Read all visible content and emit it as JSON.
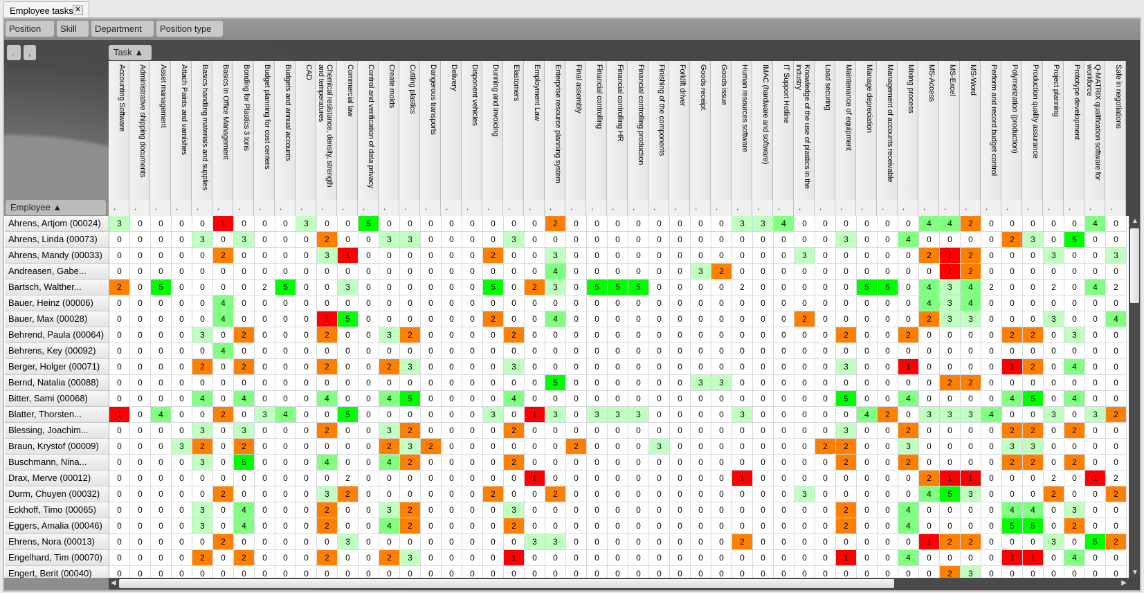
{
  "tab": {
    "title": "Employee tasks",
    "close_icon": "close-icon"
  },
  "filters": [
    "Position",
    "Skill",
    "Department",
    "Position type"
  ],
  "small_buttons": [
    ".",
    ","
  ],
  "task_sort_label": "Task ▲",
  "employee_sort_label": "Employee ▲",
  "colors": {
    "1": "#ff0000",
    "2": "#ff8000",
    "3": "#c0ffc0",
    "4": "#80ff80",
    "5": "#00ff00"
  },
  "filter_placeholder": ".",
  "tasks": [
    "Accounting Software",
    "Administrative shipping documents",
    "Asset management",
    "Attach Paints and varnishes",
    "Basics handling materials and supplies",
    "Basics in Office Management",
    "Bonding for Plastics 3 tons",
    "Budget planning for cost centers",
    "Budgets and annual accounts",
    "CAD",
    "Chemical resistance, density, strength and temperatures",
    "Commercial law",
    "Control and verification of data privacy",
    "Create molds",
    "Cutting plastics",
    "Dangerous transports",
    "Delivery",
    "Disponent vehicles",
    "Dunning and invoicing",
    "Elastomers",
    "Employment Law",
    "Enterprise resource planning system",
    "Final assembly",
    "Financial controlling",
    "Financial controlling HR",
    "Financial controlling production",
    "Finishing of the components",
    "Forklift driver",
    "Goods receipt",
    "Goods issue",
    "Human resources software",
    "IMAC (hardware and software)",
    "IT Support Hotline",
    "Knowledge of the use of plastics in the industry",
    "Load securing",
    "Maintenance of equipment",
    "Manage depreciation",
    "Management of accounts receivable",
    "Mixing process",
    "MS-Access",
    "MS-Excel",
    "MS-Word",
    "Perform and record budget control",
    "Polymerization (production)",
    "Production quality assurance",
    "Project planning",
    "Prototype development",
    "Q-MATRIX qualification software for workforce",
    "Safe in negotiations"
  ],
  "employees": [
    {
      "name": "Ahrens, Artjom (00024)",
      "values": [
        3,
        0,
        0,
        0,
        0,
        1,
        0,
        0,
        0,
        3,
        0,
        0,
        5,
        0,
        0,
        0,
        0,
        0,
        0,
        0,
        0,
        2,
        0,
        0,
        0,
        0,
        0,
        0,
        0,
        0,
        3,
        3,
        4,
        0,
        0,
        0,
        0,
        0,
        0,
        4,
        4,
        2,
        0,
        0,
        0,
        0,
        0,
        4,
        0
      ]
    },
    {
      "name": "Ahrens, Linda (00073)",
      "values": [
        0,
        0,
        0,
        0,
        3,
        0,
        3,
        0,
        0,
        0,
        2,
        0,
        0,
        3,
        3,
        0,
        0,
        0,
        0,
        3,
        0,
        0,
        0,
        0,
        0,
        0,
        0,
        0,
        0,
        0,
        0,
        0,
        0,
        0,
        0,
        3,
        0,
        0,
        4,
        0,
        0,
        0,
        0,
        2,
        3,
        0,
        5,
        0,
        0
      ]
    },
    {
      "name": "Ahrens, Mandy (00033)",
      "values": [
        0,
        0,
        0,
        0,
        0,
        2,
        0,
        0,
        0,
        0,
        3,
        1,
        0,
        0,
        0,
        0,
        0,
        0,
        2,
        0,
        0,
        3,
        0,
        0,
        0,
        0,
        0,
        0,
        0,
        0,
        0,
        0,
        0,
        3,
        0,
        0,
        0,
        0,
        0,
        2,
        1,
        2,
        0,
        0,
        0,
        3,
        0,
        0,
        3
      ]
    },
    {
      "name": "Andreasen, Gabe...",
      "values": [
        0,
        0,
        0,
        0,
        0,
        0,
        0,
        0,
        0,
        0,
        0,
        0,
        0,
        0,
        0,
        0,
        0,
        0,
        0,
        0,
        0,
        4,
        0,
        0,
        0,
        0,
        0,
        0,
        3,
        2,
        0,
        0,
        0,
        0,
        0,
        0,
        0,
        0,
        0,
        0,
        1,
        2,
        0,
        0,
        0,
        0,
        0,
        0,
        0
      ]
    },
    {
      "name": "Bartsch, Walther...",
      "values": [
        2,
        0,
        5,
        0,
        0,
        0,
        0,
        2,
        5,
        0,
        0,
        3,
        0,
        0,
        0,
        0,
        0,
        0,
        5,
        0,
        2,
        3,
        0,
        5,
        5,
        5,
        0,
        0,
        0,
        0,
        2,
        0,
        0,
        0,
        0,
        0,
        5,
        5,
        0,
        4,
        3,
        4,
        2,
        0,
        0,
        2,
        0,
        4,
        2
      ],
      "plain": [
        7,
        30,
        42,
        45,
        48
      ]
    },
    {
      "name": "Bauer, Heinz (00006)",
      "values": [
        0,
        0,
        0,
        0,
        0,
        4,
        0,
        0,
        0,
        0,
        0,
        0,
        0,
        0,
        0,
        0,
        0,
        0,
        0,
        0,
        0,
        0,
        0,
        0,
        0,
        0,
        0,
        0,
        0,
        0,
        0,
        0,
        0,
        0,
        0,
        0,
        0,
        0,
        0,
        4,
        3,
        4,
        0,
        0,
        0,
        0,
        0,
        0,
        0
      ]
    },
    {
      "name": "Bauer, Max (00028)",
      "values": [
        0,
        0,
        0,
        0,
        0,
        4,
        0,
        0,
        0,
        0,
        1,
        5,
        0,
        0,
        0,
        0,
        0,
        0,
        2,
        0,
        0,
        4,
        0,
        0,
        0,
        0,
        0,
        0,
        0,
        0,
        0,
        0,
        0,
        2,
        0,
        0,
        0,
        0,
        0,
        2,
        3,
        3,
        0,
        0,
        0,
        3,
        0,
        0,
        4
      ]
    },
    {
      "name": "Behrend, Paula (00064)",
      "values": [
        0,
        0,
        0,
        0,
        3,
        0,
        2,
        0,
        0,
        0,
        2,
        0,
        0,
        3,
        2,
        0,
        0,
        0,
        0,
        2,
        0,
        0,
        0,
        0,
        0,
        0,
        0,
        0,
        0,
        0,
        0,
        0,
        0,
        0,
        0,
        2,
        0,
        0,
        2,
        0,
        0,
        0,
        0,
        2,
        2,
        0,
        3,
        0,
        0
      ]
    },
    {
      "name": "Behrens, Key (00092)",
      "values": [
        0,
        0,
        0,
        0,
        0,
        4,
        0,
        0,
        0,
        0,
        0,
        0,
        0,
        0,
        0,
        0,
        0,
        0,
        0,
        0,
        0,
        0,
        0,
        0,
        0,
        0,
        0,
        0,
        0,
        0,
        0,
        0,
        0,
        0,
        0,
        0,
        0,
        0,
        0,
        0,
        0,
        0,
        0,
        0,
        0,
        0,
        0,
        0,
        0
      ]
    },
    {
      "name": "Berger, Holger (00071)",
      "values": [
        0,
        0,
        0,
        0,
        2,
        0,
        2,
        0,
        0,
        0,
        2,
        0,
        0,
        2,
        3,
        0,
        0,
        0,
        0,
        3,
        0,
        0,
        0,
        0,
        0,
        0,
        0,
        0,
        0,
        0,
        0,
        0,
        0,
        0,
        0,
        3,
        0,
        0,
        1,
        0,
        0,
        0,
        0,
        1,
        2,
        0,
        4,
        0,
        0
      ]
    },
    {
      "name": "Bernd, Natalia (00088)",
      "values": [
        0,
        0,
        0,
        0,
        0,
        0,
        0,
        0,
        0,
        0,
        0,
        0,
        0,
        0,
        0,
        0,
        0,
        0,
        0,
        0,
        0,
        5,
        0,
        0,
        0,
        0,
        0,
        0,
        3,
        3,
        0,
        0,
        0,
        0,
        0,
        0,
        0,
        0,
        0,
        0,
        2,
        2,
        0,
        0,
        0,
        0,
        0,
        0,
        0
      ]
    },
    {
      "name": "Bitter, Sami (00068)",
      "values": [
        0,
        0,
        0,
        0,
        4,
        0,
        4,
        0,
        0,
        0,
        4,
        0,
        0,
        4,
        5,
        0,
        0,
        0,
        0,
        4,
        0,
        0,
        0,
        0,
        0,
        0,
        0,
        0,
        0,
        0,
        0,
        0,
        0,
        0,
        0,
        5,
        0,
        0,
        4,
        0,
        0,
        0,
        0,
        4,
        5,
        0,
        4,
        0,
        0
      ]
    },
    {
      "name": "Blatter, Thorsten...",
      "values": [
        1,
        0,
        4,
        0,
        0,
        2,
        0,
        3,
        4,
        0,
        0,
        5,
        0,
        0,
        0,
        0,
        0,
        0,
        3,
        0,
        1,
        3,
        0,
        3,
        3,
        3,
        0,
        0,
        0,
        0,
        3,
        0,
        0,
        0,
        0,
        0,
        4,
        2,
        0,
        3,
        3,
        3,
        4,
        0,
        0,
        3,
        0,
        3,
        2
      ]
    },
    {
      "name": "Blessing, Joachim...",
      "values": [
        0,
        0,
        0,
        0,
        3,
        0,
        3,
        0,
        0,
        0,
        2,
        0,
        0,
        3,
        2,
        0,
        0,
        0,
        0,
        2,
        0,
        0,
        0,
        0,
        0,
        0,
        0,
        0,
        0,
        0,
        0,
        0,
        0,
        0,
        0,
        3,
        0,
        0,
        2,
        0,
        0,
        0,
        0,
        2,
        2,
        0,
        2,
        0,
        0
      ]
    },
    {
      "name": "Braun, Krystof (00009)",
      "values": [
        0,
        0,
        0,
        3,
        2,
        0,
        2,
        0,
        0,
        0,
        0,
        0,
        0,
        2,
        3,
        2,
        0,
        0,
        0,
        0,
        0,
        0,
        2,
        0,
        0,
        0,
        3,
        0,
        0,
        0,
        0,
        0,
        0,
        0,
        2,
        2,
        0,
        0,
        3,
        0,
        0,
        0,
        0,
        3,
        3,
        0,
        0,
        0,
        0
      ]
    },
    {
      "name": "Buschmann, Nina...",
      "values": [
        0,
        0,
        0,
        0,
        3,
        0,
        5,
        0,
        0,
        0,
        4,
        0,
        0,
        4,
        2,
        0,
        0,
        0,
        0,
        2,
        0,
        0,
        0,
        0,
        0,
        0,
        0,
        0,
        0,
        0,
        0,
        0,
        0,
        0,
        0,
        2,
        0,
        0,
        2,
        0,
        0,
        0,
        0,
        2,
        2,
        0,
        2,
        0,
        0
      ]
    },
    {
      "name": "Drax, Merve (00012)",
      "values": [
        0,
        0,
        0,
        0,
        0,
        0,
        0,
        0,
        0,
        0,
        0,
        2,
        0,
        0,
        0,
        0,
        0,
        0,
        0,
        0,
        1,
        0,
        0,
        0,
        0,
        0,
        0,
        0,
        0,
        0,
        1,
        0,
        0,
        0,
        0,
        0,
        0,
        0,
        0,
        2,
        1,
        1,
        0,
        0,
        0,
        2,
        0,
        1,
        2
      ],
      "plain": [
        11,
        45,
        48
      ]
    },
    {
      "name": "Durm, Chuyen (00032)",
      "values": [
        0,
        0,
        0,
        0,
        0,
        2,
        0,
        0,
        0,
        0,
        3,
        2,
        0,
        0,
        0,
        0,
        0,
        0,
        2,
        0,
        0,
        2,
        0,
        0,
        0,
        0,
        0,
        0,
        0,
        0,
        0,
        0,
        0,
        3,
        0,
        0,
        0,
        0,
        0,
        4,
        5,
        3,
        0,
        0,
        0,
        2,
        0,
        0,
        2
      ]
    },
    {
      "name": "Eckhoff, Timo (00065)",
      "values": [
        0,
        0,
        0,
        0,
        3,
        0,
        4,
        0,
        0,
        0,
        2,
        0,
        0,
        3,
        2,
        0,
        0,
        0,
        0,
        3,
        0,
        0,
        0,
        0,
        0,
        0,
        0,
        0,
        0,
        0,
        0,
        0,
        0,
        0,
        0,
        2,
        0,
        0,
        4,
        0,
        0,
        0,
        0,
        4,
        4,
        0,
        3,
        0,
        0
      ]
    },
    {
      "name": "Eggers, Amalia (00046)",
      "values": [
        0,
        0,
        0,
        0,
        3,
        0,
        4,
        0,
        0,
        0,
        2,
        0,
        0,
        4,
        2,
        0,
        0,
        0,
        0,
        2,
        0,
        0,
        0,
        0,
        0,
        0,
        0,
        0,
        0,
        0,
        0,
        0,
        0,
        0,
        0,
        2,
        0,
        0,
        4,
        0,
        0,
        0,
        0,
        5,
        5,
        0,
        2,
        0,
        0
      ]
    },
    {
      "name": "Ehrens, Nora (00013)",
      "values": [
        0,
        0,
        0,
        0,
        0,
        2,
        0,
        0,
        0,
        0,
        0,
        3,
        0,
        0,
        0,
        0,
        0,
        0,
        0,
        0,
        3,
        3,
        0,
        0,
        0,
        0,
        0,
        0,
        0,
        0,
        2,
        0,
        0,
        0,
        0,
        0,
        0,
        0,
        0,
        1,
        2,
        2,
        0,
        0,
        0,
        3,
        0,
        5,
        2
      ]
    },
    {
      "name": "Engelhard, Tim (00070)",
      "values": [
        0,
        0,
        0,
        0,
        2,
        0,
        2,
        0,
        0,
        0,
        2,
        0,
        0,
        2,
        3,
        0,
        0,
        0,
        0,
        1,
        0,
        0,
        0,
        0,
        0,
        0,
        0,
        0,
        0,
        0,
        0,
        0,
        0,
        0,
        0,
        1,
        0,
        0,
        4,
        0,
        0,
        0,
        0,
        1,
        1,
        0,
        4,
        0,
        0
      ]
    },
    {
      "name": "Engert, Berit (00040)",
      "values": [
        0,
        0,
        0,
        0,
        0,
        0,
        0,
        0,
        0,
        0,
        0,
        0,
        0,
        0,
        0,
        0,
        0,
        0,
        0,
        0,
        0,
        0,
        0,
        0,
        0,
        0,
        0,
        0,
        0,
        0,
        0,
        0,
        0,
        0,
        0,
        0,
        0,
        0,
        0,
        0,
        2,
        3,
        0,
        0,
        0,
        0,
        0,
        0,
        0
      ]
    }
  ]
}
